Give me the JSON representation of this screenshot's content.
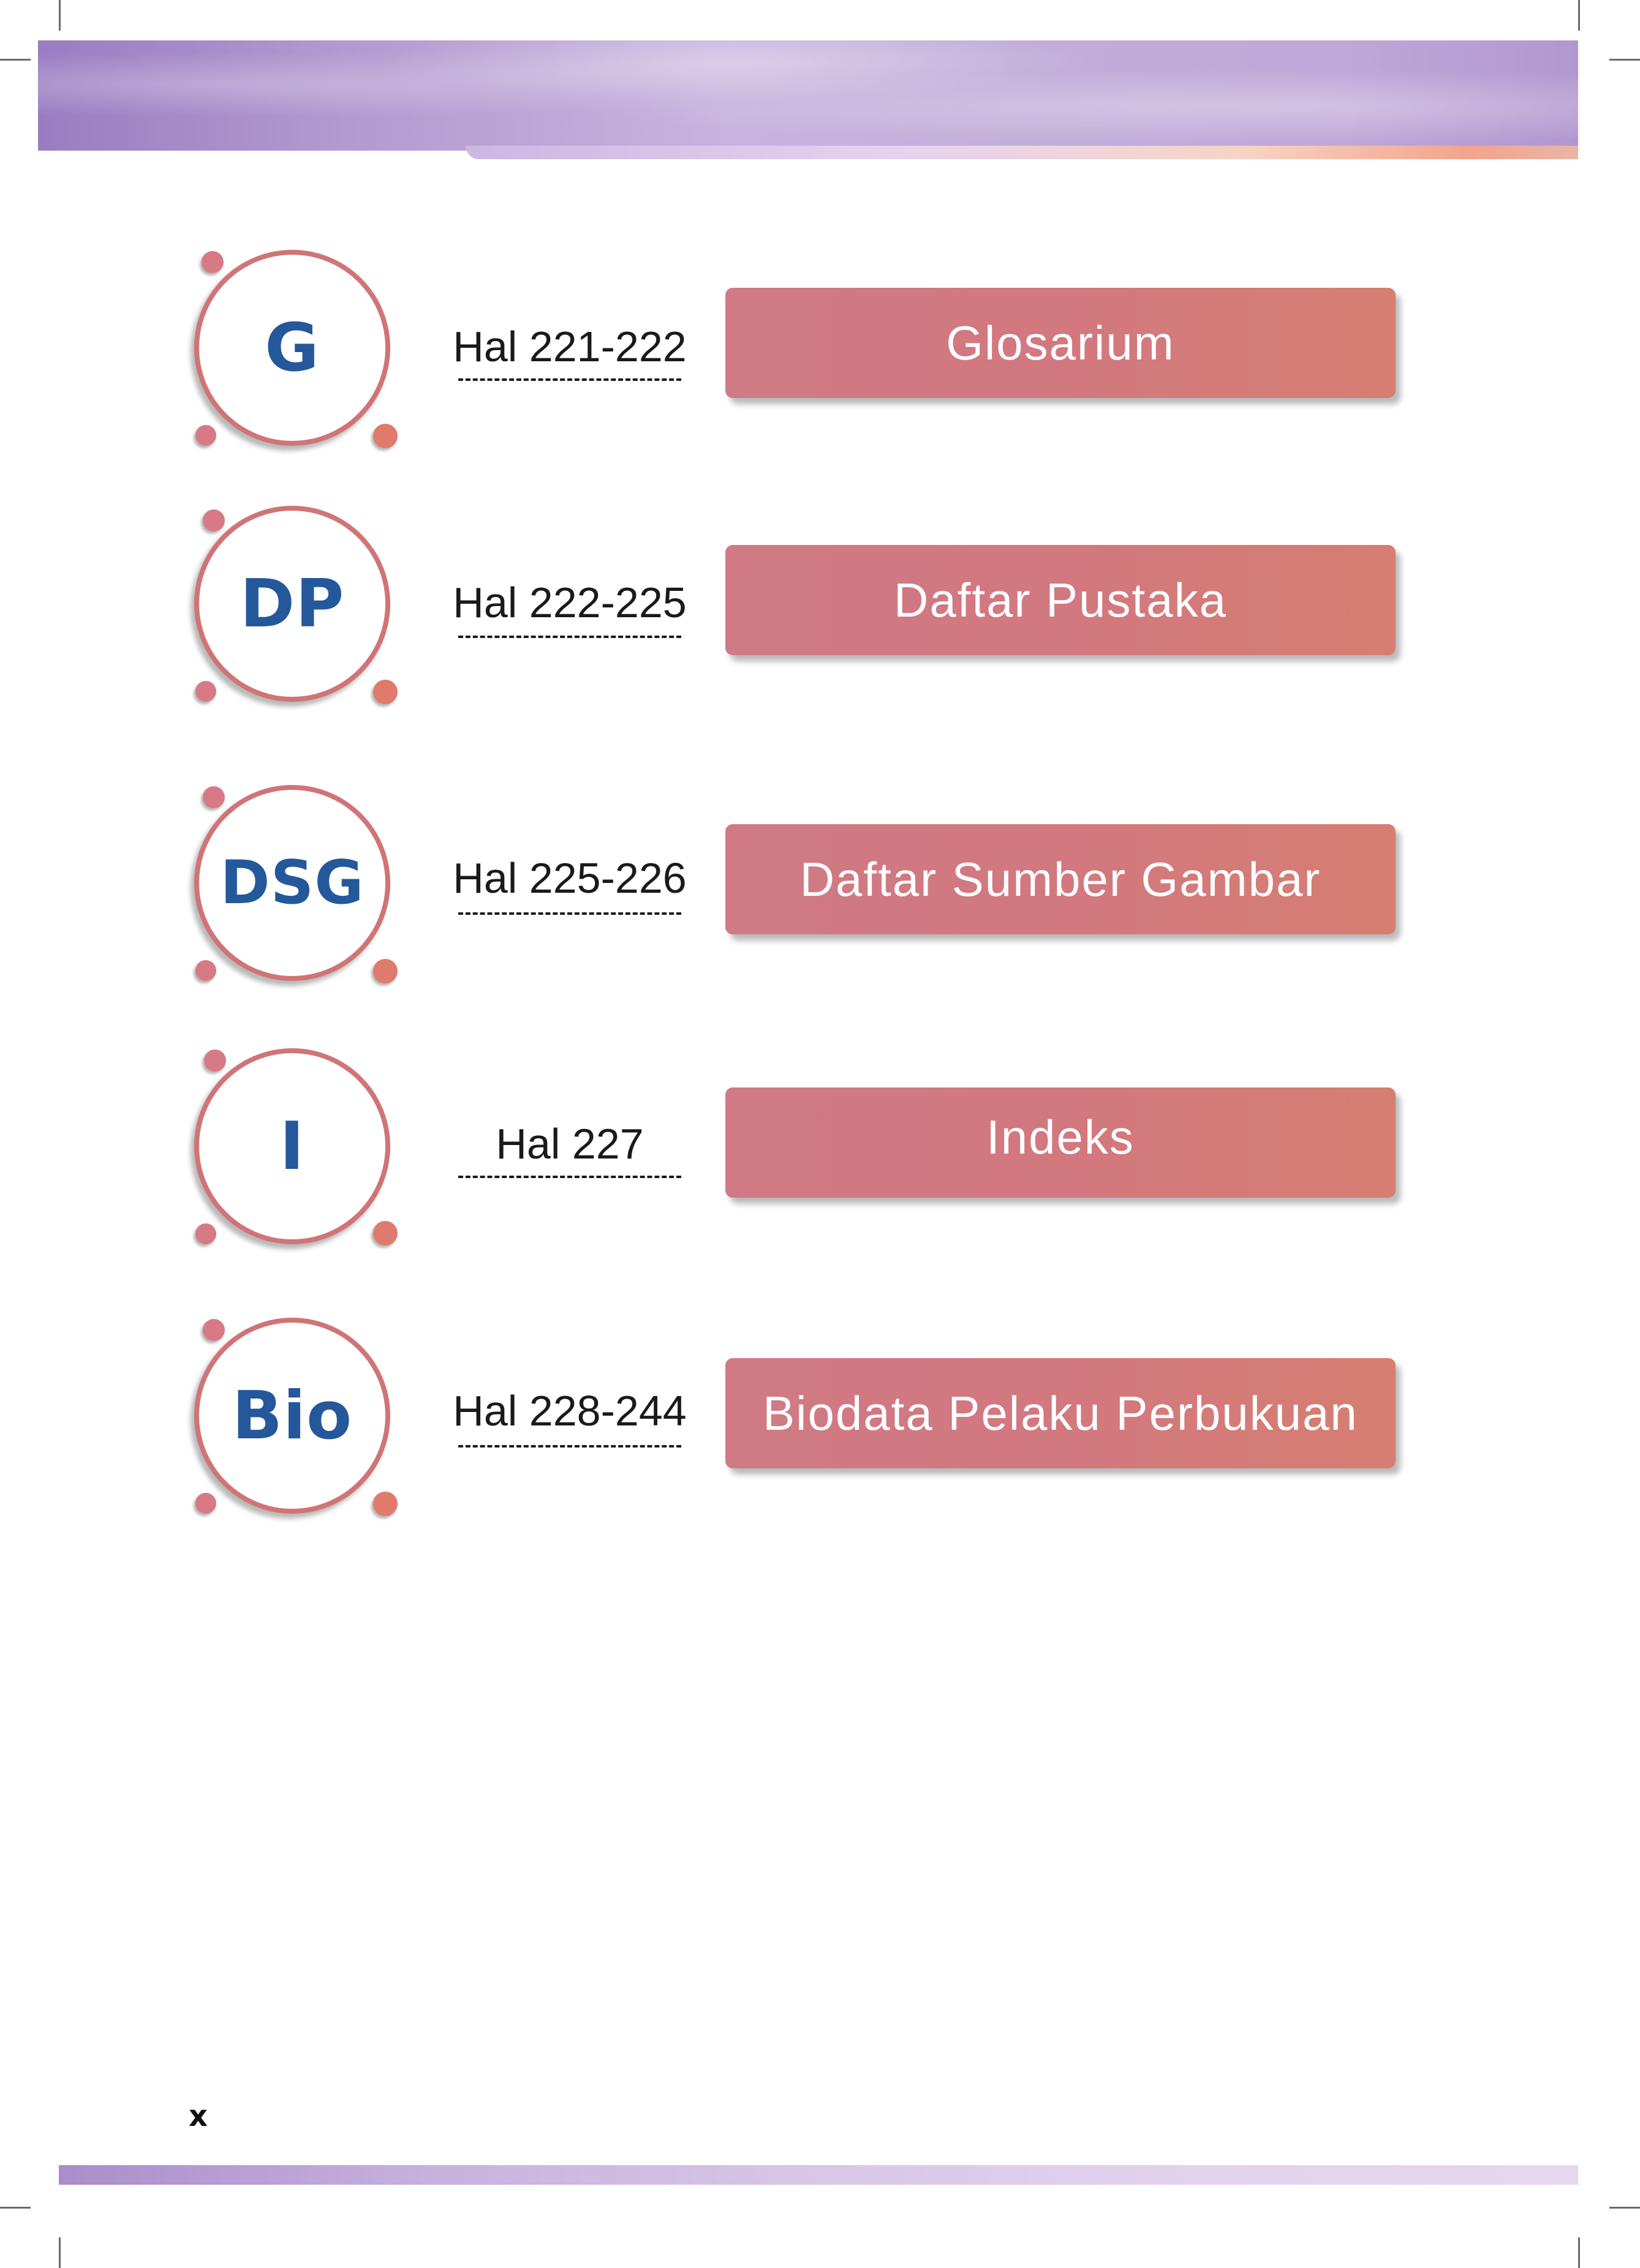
{
  "entries": [
    {
      "code": "G",
      "pages": "Hal 221-222",
      "title": "Glosarium"
    },
    {
      "code": "DP",
      "pages": "Hal 222-225",
      "title": "Daftar Pustaka"
    },
    {
      "code": "DSG",
      "pages": "Hal 225-226",
      "title": "Daftar Sumber Gambar"
    },
    {
      "code": "I",
      "pages": "Hal 227",
      "title": "Indeks"
    },
    {
      "code": "Bio",
      "pages": "Hal 228-244",
      "title": "Biodata Pelaku Perbukuan"
    }
  ],
  "footer": {
    "page_number": "x"
  },
  "colors": {
    "accent": "#d07476",
    "code_text": "#24589b",
    "banner": "#b39ad0",
    "dot_pink": "#d77a86",
    "dot_coral": "#e07a6c"
  }
}
